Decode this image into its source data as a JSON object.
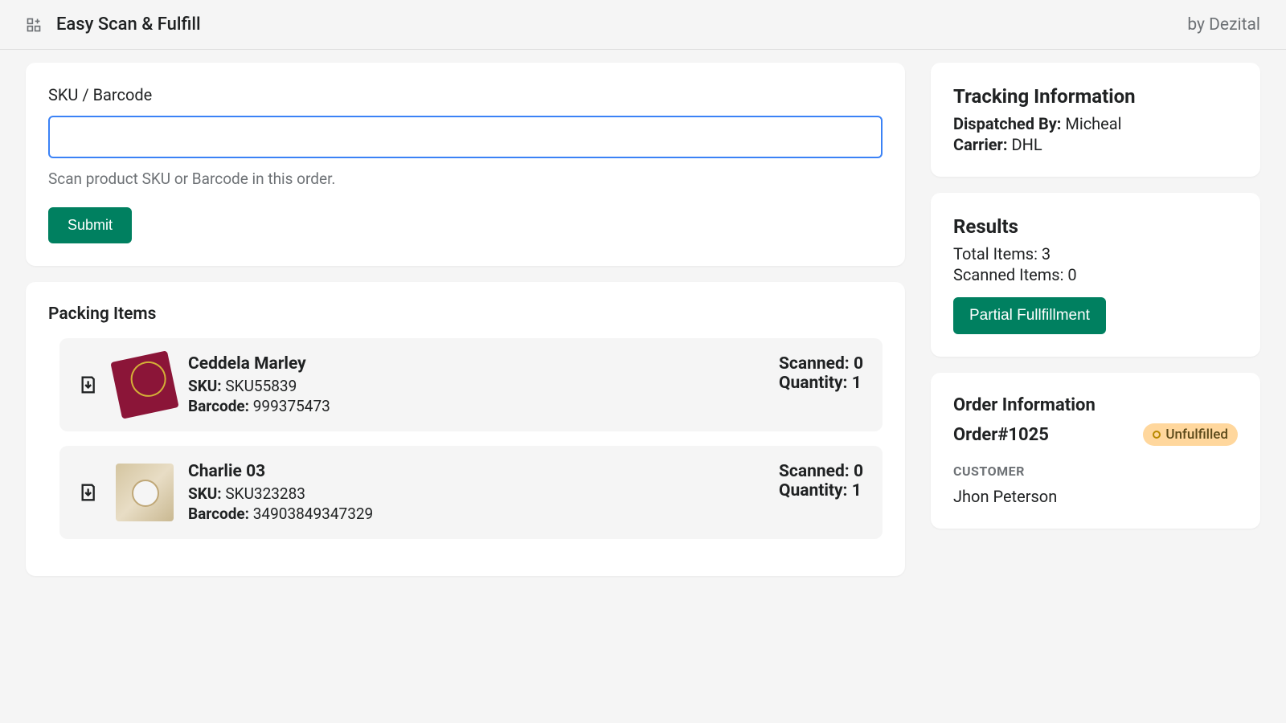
{
  "header": {
    "title": "Easy Scan & Fulfill",
    "by": "by Dezital"
  },
  "scan": {
    "label": "SKU / Barcode",
    "value": "",
    "hint": "Scan product SKU or Barcode in this order.",
    "submit": "Submit"
  },
  "packing": {
    "title": "Packing Items",
    "items": [
      {
        "name": "Ceddela Marley",
        "sku_label": "SKU:",
        "sku": "SKU55839",
        "barcode_label": "Barcode:",
        "barcode": "999375473",
        "scanned_label": "Scanned:",
        "scanned": "0",
        "quantity_label": "Quantity:",
        "quantity": "1"
      },
      {
        "name": "Charlie 03",
        "sku_label": "SKU:",
        "sku": "SKU323283",
        "barcode_label": "Barcode:",
        "barcode": "34903849347329",
        "scanned_label": "Scanned:",
        "scanned": "0",
        "quantity_label": "Quantity:",
        "quantity": "1"
      }
    ]
  },
  "tracking": {
    "title": "Tracking Information",
    "dispatched_label": "Dispatched By:",
    "dispatched_by": "Micheal",
    "carrier_label": "Carrier:",
    "carrier": "DHL"
  },
  "results": {
    "title": "Results",
    "total_label": "Total Items:",
    "total": "3",
    "scanned_label": "Scanned Items:",
    "scanned": "0",
    "action": "Partial Fullfillment"
  },
  "order": {
    "title": "Order Information",
    "order_number": "Order#1025",
    "status": "Unfulfilled",
    "customer_label": "CUSTOMER",
    "customer_name": "Jhon Peterson"
  }
}
